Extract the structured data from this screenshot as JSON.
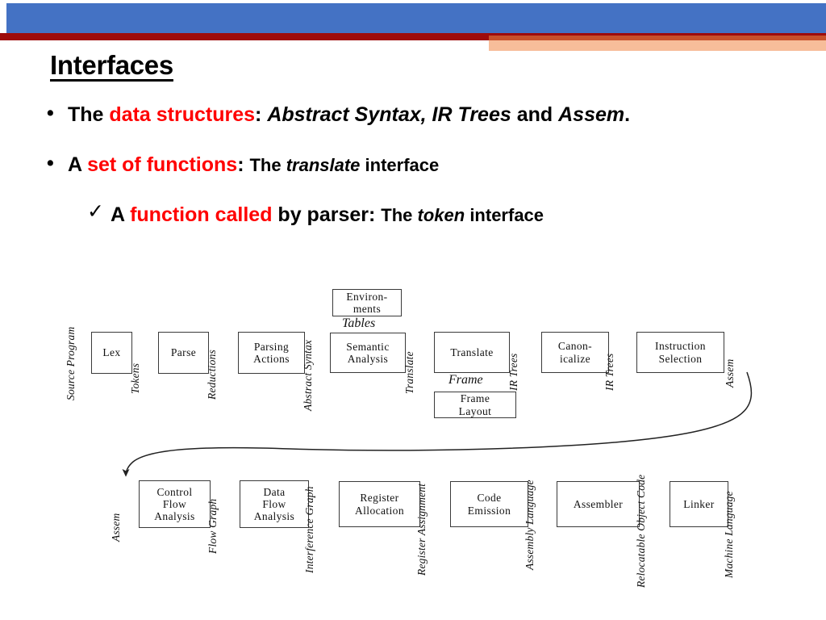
{
  "header": {
    "colors": {
      "blue_bar": "#4472c4",
      "dark_red": "#9e0b0b",
      "orange": "#c8502a",
      "peach": "#f7bd9a",
      "accent_red": "#ff0000"
    }
  },
  "title": "Interfaces",
  "bullets": [
    {
      "marker": "•",
      "level": 1,
      "segments": [
        {
          "text": "The ",
          "style": "bold"
        },
        {
          "text": "data structures",
          "style": "bold-red"
        },
        {
          "text": ": ",
          "style": "bold"
        },
        {
          "text": "Abstract Syntax, IR Trees",
          "style": "bold-italic"
        },
        {
          "text": " and ",
          "style": "bold"
        },
        {
          "text": "Assem",
          "style": "bold-italic"
        },
        {
          "text": ".",
          "style": "bold"
        }
      ]
    },
    {
      "marker": "•",
      "level": 1,
      "segments": [
        {
          "text": "A ",
          "style": "bold"
        },
        {
          "text": "set of functions",
          "style": "bold-red"
        },
        {
          "text": ": ",
          "style": "bold"
        },
        {
          "text": "The ",
          "style": "bold-small"
        },
        {
          "text": "translate",
          "style": "bold-italic-small"
        },
        {
          "text": " interface",
          "style": "bold-small"
        }
      ]
    },
    {
      "marker": "✓",
      "level": 2,
      "segments": [
        {
          "text": "A ",
          "style": "bold"
        },
        {
          "text": "function called",
          "style": "bold-red"
        },
        {
          "text": " by parser",
          "style": "bold"
        },
        {
          "text": ": ",
          "style": "bold"
        },
        {
          "text": "The ",
          "style": "bold-small"
        },
        {
          "text": "token",
          "style": "bold-italic-small"
        },
        {
          "text": " interface",
          "style": "bold-small"
        }
      ]
    }
  ],
  "diagram": {
    "caption": "compiler-phases-flow",
    "boxes": [
      {
        "id": "lex",
        "label": "Lex"
      },
      {
        "id": "parse",
        "label": "Parse"
      },
      {
        "id": "parsing-actions",
        "label": "Parsing\nActions"
      },
      {
        "id": "environments",
        "label": "Environ-\nments"
      },
      {
        "id": "semantic-analysis",
        "label": "Semantic\nAnalysis"
      },
      {
        "id": "translate",
        "label": "Translate"
      },
      {
        "id": "frame-layout",
        "label": "Frame\nLayout"
      },
      {
        "id": "canonicalize",
        "label": "Canon-\nicalize"
      },
      {
        "id": "instruction-selection",
        "label": "Instruction\nSelection"
      },
      {
        "id": "control-flow-analysis",
        "label": "Control\nFlow\nAnalysis"
      },
      {
        "id": "data-flow-analysis",
        "label": "Data\nFlow\nAnalysis"
      },
      {
        "id": "register-allocation",
        "label": "Register\nAllocation"
      },
      {
        "id": "code-emission",
        "label": "Code\nEmission"
      },
      {
        "id": "assembler",
        "label": "Assembler"
      },
      {
        "id": "linker",
        "label": "Linker"
      }
    ],
    "edge_labels": [
      {
        "id": "source-program",
        "label": "Source Program"
      },
      {
        "id": "tokens",
        "label": "Tokens"
      },
      {
        "id": "reductions",
        "label": "Reductions"
      },
      {
        "id": "abstract-syntax",
        "label": "Abstract Syntax"
      },
      {
        "id": "translate-edge",
        "label": "Translate"
      },
      {
        "id": "ir-trees-1",
        "label": "IR Trees"
      },
      {
        "id": "ir-trees-2",
        "label": "IR Trees"
      },
      {
        "id": "assem-top",
        "label": "Assem"
      },
      {
        "id": "assem-bottom",
        "label": "Assem"
      },
      {
        "id": "flow-graph",
        "label": "Flow Graph"
      },
      {
        "id": "interference-graph",
        "label": "Interference Graph"
      },
      {
        "id": "register-assignment",
        "label": "Register Assignment"
      },
      {
        "id": "assembly-language",
        "label": "Assembly Language"
      },
      {
        "id": "relocatable-object-code",
        "label": "Relocatable Object Code"
      },
      {
        "id": "machine-language",
        "label": "Machine Language"
      }
    ],
    "flat_labels": [
      {
        "id": "tables",
        "label": "Tables"
      },
      {
        "id": "frame",
        "label": "Frame"
      }
    ]
  }
}
